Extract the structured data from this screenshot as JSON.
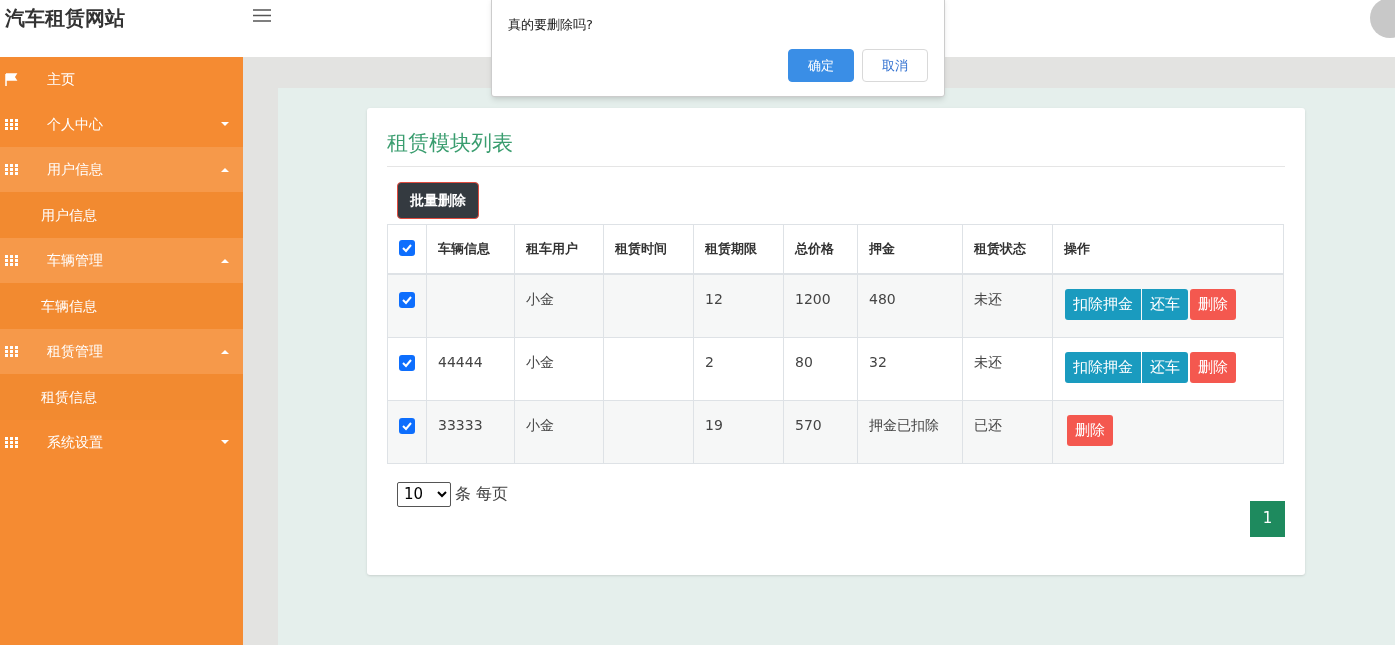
{
  "header": {
    "title": "汽车租赁网站"
  },
  "sidebar": {
    "items": [
      {
        "label": "主页",
        "kind": "link"
      },
      {
        "label": "个人中心",
        "kind": "group",
        "expanded": false
      },
      {
        "label": "用户信息",
        "kind": "group",
        "expanded": true,
        "children": [
          {
            "label": "用户信息"
          }
        ]
      },
      {
        "label": "车辆管理",
        "kind": "group",
        "expanded": true,
        "children": [
          {
            "label": "车辆信息"
          }
        ]
      },
      {
        "label": "租赁管理",
        "kind": "group",
        "expanded": true,
        "children": [
          {
            "label": "租赁信息"
          }
        ]
      },
      {
        "label": "系统设置",
        "kind": "group",
        "expanded": false
      }
    ]
  },
  "dialog": {
    "message": "真的要删除吗?",
    "buttons": [
      {
        "label": "确定",
        "kind": "primary"
      },
      {
        "label": "取消",
        "kind": "secondary"
      }
    ]
  },
  "card": {
    "title": "租赁模块列表",
    "batch_delete": "批量删除",
    "table": {
      "all_checked": true,
      "columns": [
        "车辆信息",
        "租车用户",
        "租赁时间",
        "租赁期限",
        "总价格",
        "押金",
        "租赁状态",
        "操作"
      ],
      "rows": [
        {
          "checked": true,
          "cells": [
            "",
            "小金",
            "",
            "12",
            "1200",
            "480",
            "未还"
          ],
          "actions": [
            {
              "label": "扣除押金",
              "kind": "deduct"
            },
            {
              "label": "还车",
              "kind": "return"
            },
            {
              "label": "删除",
              "kind": "delete"
            }
          ]
        },
        {
          "checked": true,
          "cells": [
            "44444",
            "小金",
            "",
            "2",
            "80",
            "32",
            "未还"
          ],
          "actions": [
            {
              "label": "扣除押金",
              "kind": "deduct"
            },
            {
              "label": "还车",
              "kind": "return"
            },
            {
              "label": "删除",
              "kind": "delete"
            }
          ]
        },
        {
          "checked": true,
          "cells": [
            "33333",
            "小金",
            "",
            "19",
            "570",
            "押金已扣除",
            "已还"
          ],
          "actions": [
            {
              "label": "删除",
              "kind": "delete"
            }
          ]
        }
      ]
    },
    "page_size": "10",
    "page_size_label": "条 每页",
    "pages": [
      {
        "label": "1",
        "selected": true
      }
    ]
  }
}
